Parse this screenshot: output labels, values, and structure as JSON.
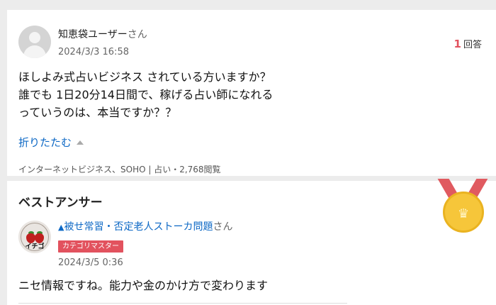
{
  "question": {
    "user_name": "知恵袋ユーザー",
    "user_suffix": "さん",
    "date": "2024/3/3 16:58",
    "answer_count": "1",
    "answer_count_label": "回答",
    "body_lines": [
      "ほしよみ式占いビジネス されている方いますか？",
      "誰でも 1日20分14日間で、稼げる占い師になれる",
      "っていうのは、本当ですか？？"
    ],
    "collapse_label": "折りたたむ",
    "category_text": "インターネットビジネス、SOHO | 占い・2,768閲覧"
  },
  "best_answer": {
    "section_title": "ベストアンサー",
    "user_prefix": "▲",
    "user_name": "被せ常習・否定老人ストーカ問題",
    "user_suffix": "さん",
    "badge": "カテゴリマスター",
    "avatar_text": "イチゴ",
    "date": "2024/3/5 0:36",
    "body": "ニセ情報ですね。能力や金のかけ方で変わります"
  },
  "colors": {
    "accent_red": "#e2525e",
    "link_blue": "#0d68c5",
    "medal_gold": "#f6c63a"
  },
  "icons": {
    "default_avatar": "user-silhouette-icon",
    "collapse": "caret-up-icon",
    "best_answer_medal": "gold-medal-crown-icon"
  }
}
